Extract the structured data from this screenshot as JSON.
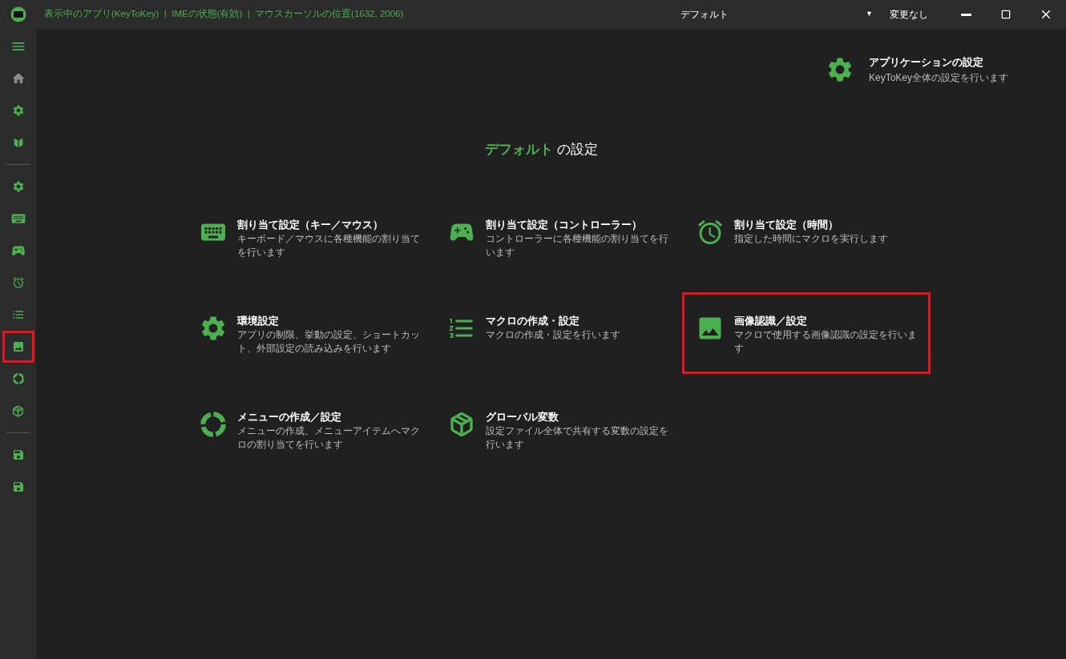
{
  "title_bar": {
    "status": "表示中のアプリ(KeyToKey)  |  IMEの状態(有効)  |  マウスカーソルの位置(1632, 2006)",
    "profile": "デフォルト",
    "dropdown_arrow": "▼",
    "change_state": "変更なし"
  },
  "sidebar": {
    "items": [
      {
        "kind": "item",
        "highlighted": false
      },
      {
        "kind": "item",
        "highlighted": false
      },
      {
        "kind": "item",
        "highlighted": false
      },
      {
        "kind": "item",
        "highlighted": false
      },
      {
        "kind": "divider"
      },
      {
        "kind": "item",
        "highlighted": false
      },
      {
        "kind": "item",
        "highlighted": false
      },
      {
        "kind": "item",
        "highlighted": false
      },
      {
        "kind": "item",
        "highlighted": false
      },
      {
        "kind": "item",
        "highlighted": false
      },
      {
        "kind": "item",
        "highlighted": true
      },
      {
        "kind": "item",
        "highlighted": false
      },
      {
        "kind": "item",
        "highlighted": false
      },
      {
        "kind": "divider"
      },
      {
        "kind": "item",
        "highlighted": false
      },
      {
        "kind": "item",
        "highlighted": false
      }
    ]
  },
  "app_settings": {
    "title": "アプリケーションの設定",
    "description": "KeyToKey全体の設定を行います"
  },
  "heading": {
    "profile": "デフォルト",
    "suffix": "の設定"
  },
  "cards": [
    {
      "title": "割り当て設定（キー／マウス）",
      "description": "キーボード／マウスに各種機能の割り当てを行います",
      "highlighted": false
    },
    {
      "title": "割り当て設定（コントローラー）",
      "description": "コントローラーに各種機能の割り当てを行います",
      "highlighted": false
    },
    {
      "title": "割り当て設定（時間）",
      "description": "指定した時間にマクロを実行します",
      "highlighted": false
    },
    {
      "title": "環境設定",
      "description": "アプリの制限、挙動の設定、ショートカット、外部設定の読み込みを行います",
      "highlighted": false
    },
    {
      "title": "マクロの作成・設定",
      "description": "マクロの作成・設定を行います",
      "highlighted": false
    },
    {
      "title": "画像認識／設定",
      "description": "マクロで使用する画像認識の設定を行います",
      "highlighted": true
    },
    {
      "title": "メニューの作成／設定",
      "description": "メニューの作成、メニューアイテムへマクロの割り当てを行います",
      "highlighted": false
    },
    {
      "title": "グローバル変数",
      "description": "設定ファイル全体で共有する変数の設定を行います",
      "highlighted": false
    }
  ]
}
